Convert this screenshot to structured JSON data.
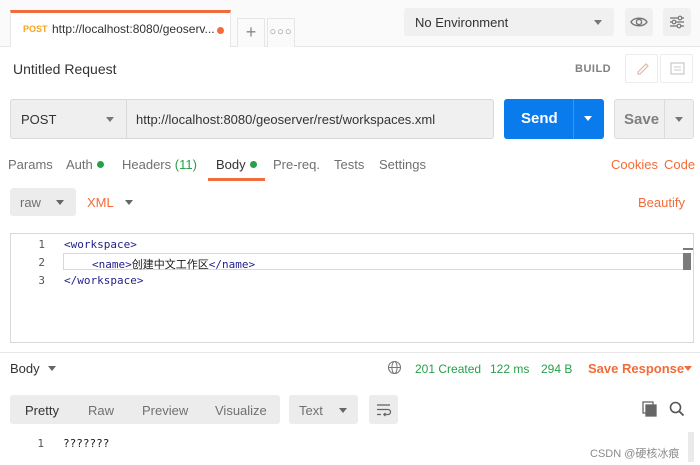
{
  "tab": {
    "method": "POST",
    "title": "http://localhost:8080/geoserv..."
  },
  "environment": {
    "selected": "No Environment"
  },
  "request": {
    "title": "Untitled Request",
    "build_label": "BUILD",
    "method": "POST",
    "url": "http://localhost:8080/geoserver/rest/workspaces.xml",
    "send_label": "Send",
    "save_label": "Save"
  },
  "request_tabs": {
    "params": "Params",
    "auth": "Auth",
    "headers": "Headers",
    "headers_count": "(11)",
    "body": "Body",
    "prereq": "Pre-req.",
    "tests": "Tests",
    "settings": "Settings",
    "cookies": "Cookies",
    "code": "Code"
  },
  "body_options": {
    "mode": "raw",
    "language": "XML",
    "beautify": "Beautify"
  },
  "editor": {
    "line_numbers": [
      "1",
      "2",
      "3"
    ],
    "line1": "<workspace>",
    "line2_open": "<name>",
    "line2_text": "创建中文工作区",
    "line2_close": "</name>",
    "line3": "</workspace>"
  },
  "response": {
    "body_label": "Body",
    "status": "201 Created",
    "time": "122 ms",
    "size": "294 B",
    "save_response": "Save Response",
    "view_tabs": {
      "pretty": "Pretty",
      "raw": "Raw",
      "preview": "Preview",
      "visualize": "Visualize"
    },
    "format": "Text",
    "line_number": "1",
    "content": "???????"
  },
  "watermark": "CSDN @硬核冰痕",
  "colors": {
    "accent": "#f26b3a",
    "send_blue": "#097bed",
    "success": "#26a14a"
  }
}
